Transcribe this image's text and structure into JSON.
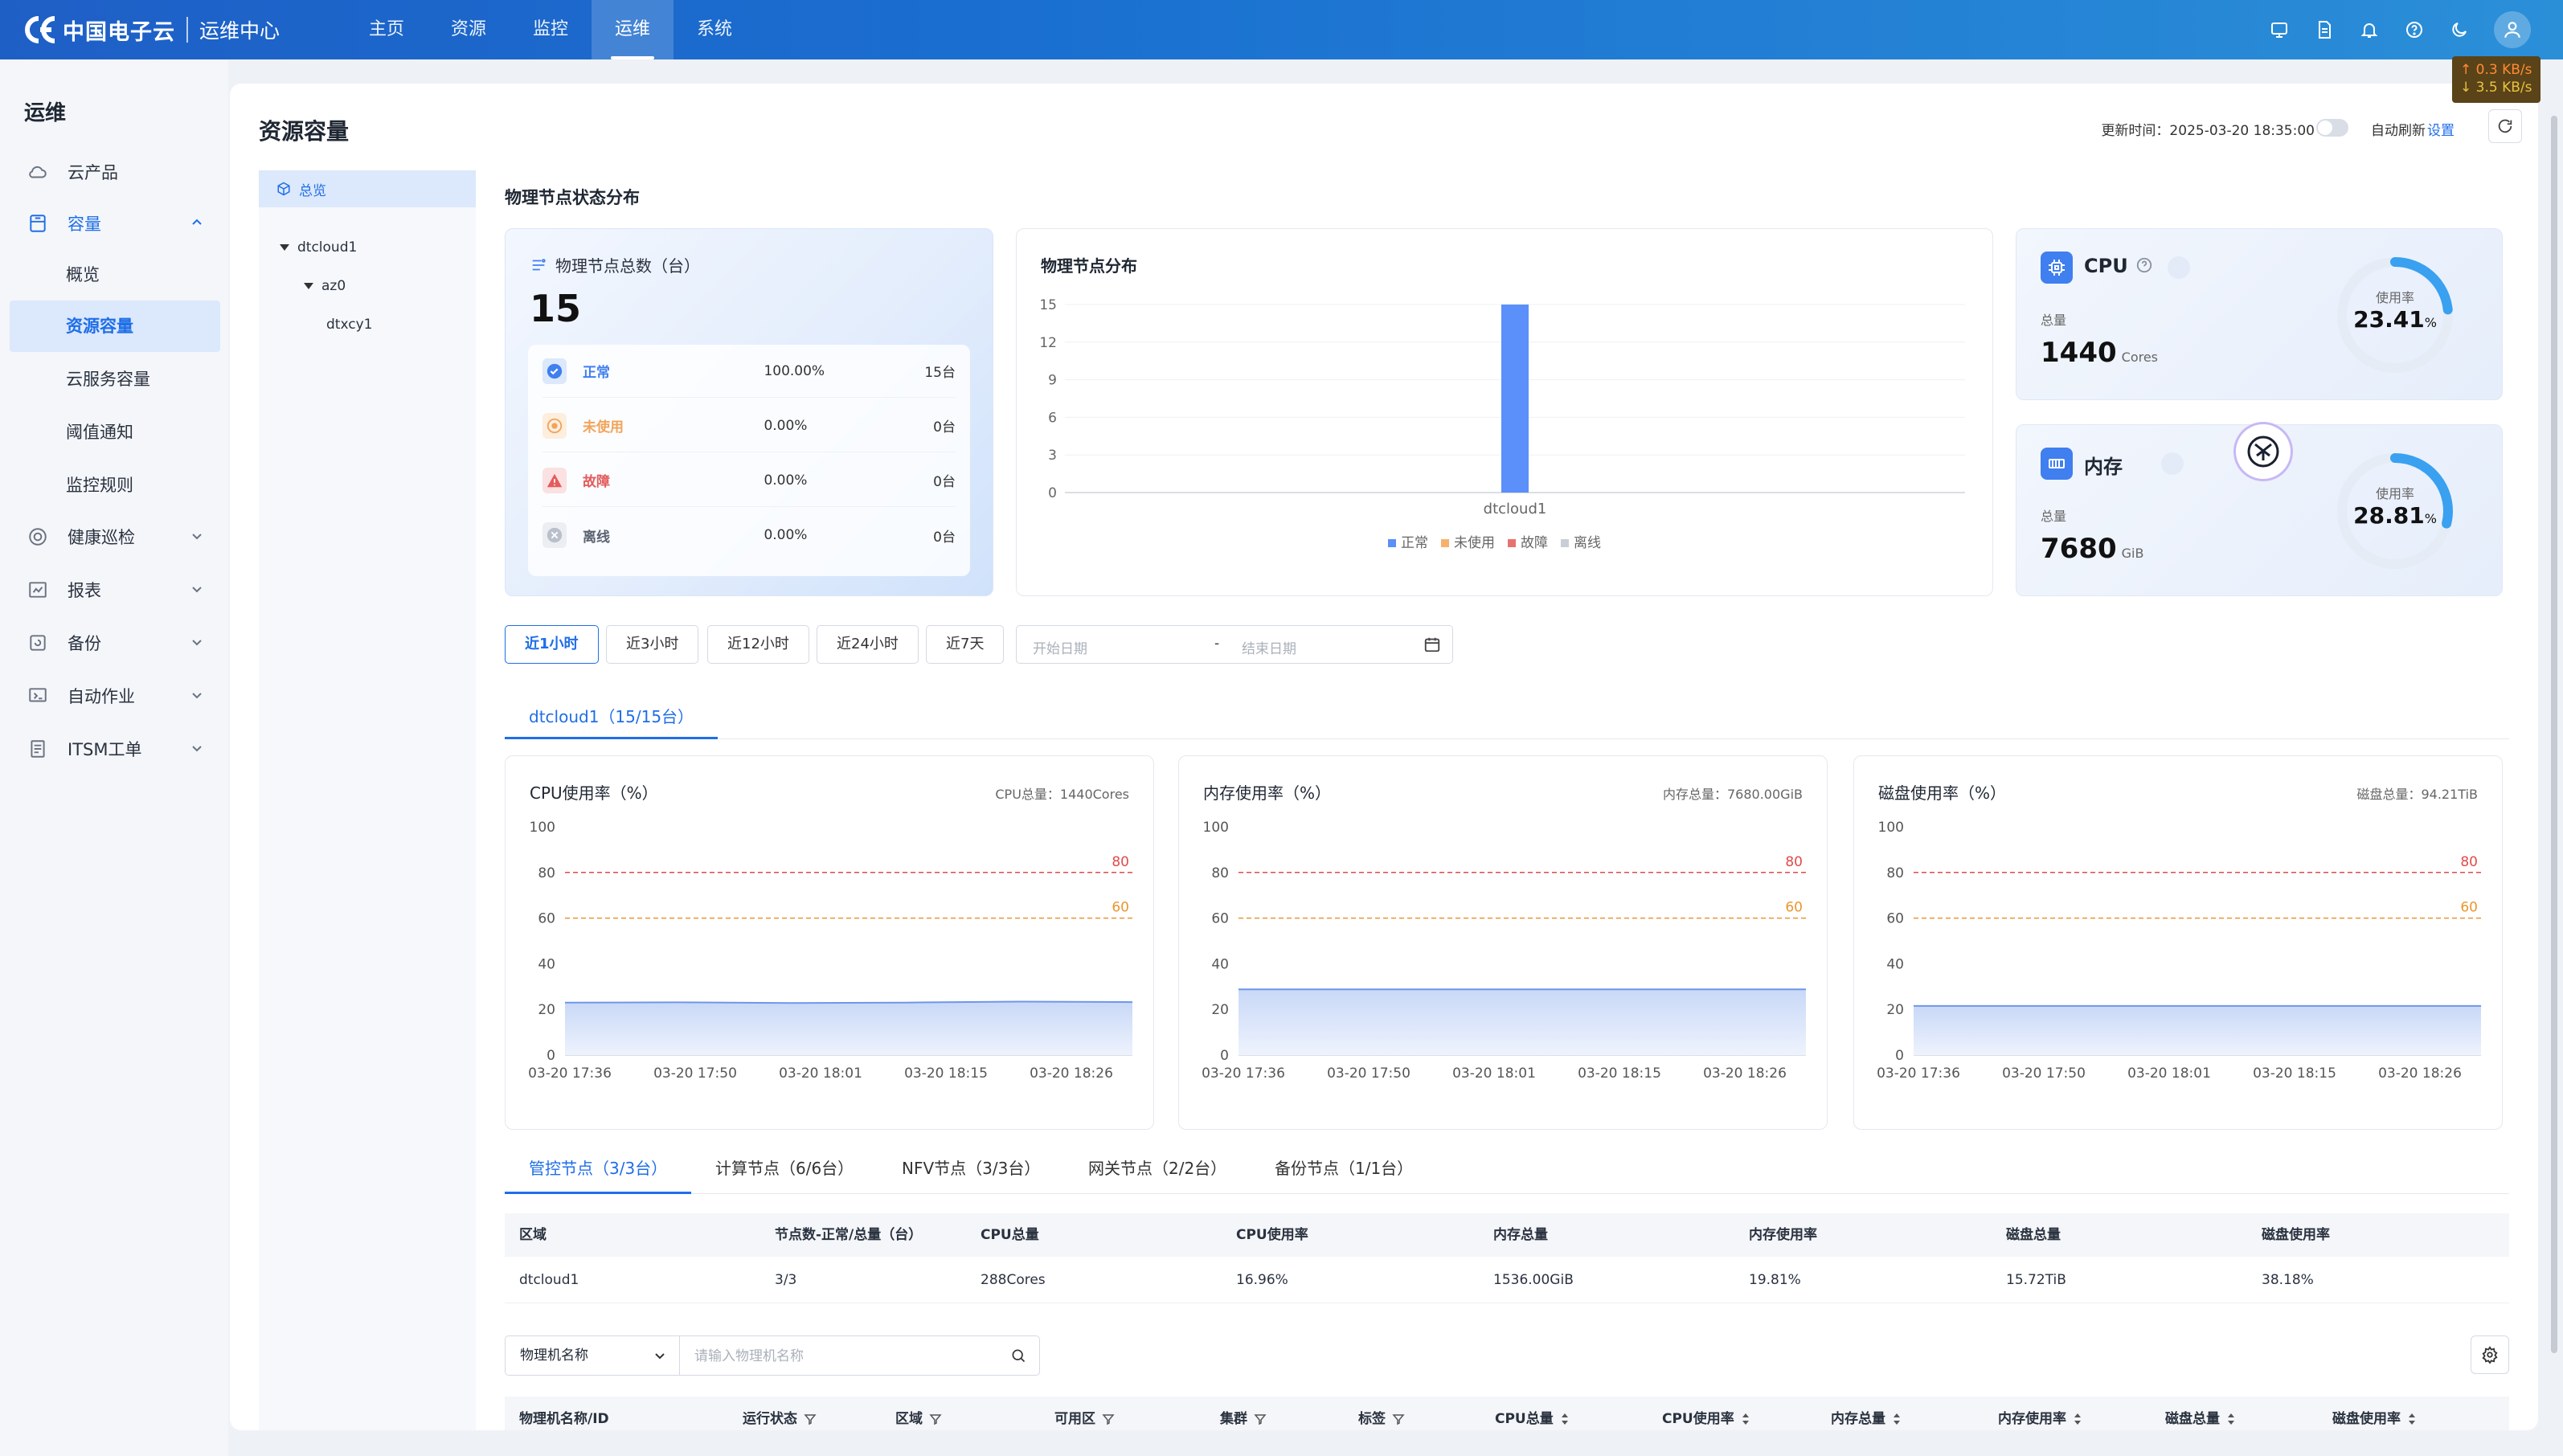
{
  "header": {
    "logo_text": "中国电子云",
    "logo_sub": "运维中心",
    "nav": [
      {
        "label": "主页"
      },
      {
        "label": "资源"
      },
      {
        "label": "监控"
      },
      {
        "label": "运维",
        "active": true
      },
      {
        "label": "系统"
      }
    ],
    "icons": [
      "monitor-icon",
      "document-icon",
      "bell-icon",
      "help-icon",
      "moon-icon"
    ],
    "net_speed": {
      "up": "↑ 0.3 KB/s",
      "down": "↓ 3.5 KB/s"
    }
  },
  "sidebar": {
    "title": "运维",
    "items": [
      {
        "label": "云产品",
        "icon": "cloud-icon"
      },
      {
        "label": "容量",
        "icon": "capacity-icon",
        "open": true,
        "children": [
          {
            "label": "概览"
          },
          {
            "label": "资源容量",
            "active": true
          },
          {
            "label": "云服务容量"
          },
          {
            "label": "阈值通知"
          },
          {
            "label": "监控规则"
          }
        ]
      },
      {
        "label": "健康巡检",
        "icon": "health-icon"
      },
      {
        "label": "报表",
        "icon": "report-icon"
      },
      {
        "label": "备份",
        "icon": "backup-icon"
      },
      {
        "label": "自动作业",
        "icon": "automation-icon"
      },
      {
        "label": "ITSM工单",
        "icon": "ticket-icon"
      }
    ]
  },
  "page": {
    "title": "资源容量",
    "updated": "更新时间：2025-03-20 18:35:00",
    "auto_refresh": "自动刷新",
    "settings": "设置"
  },
  "tree": {
    "overview": "总览",
    "region": "dtcloud1",
    "az": "az0",
    "cluster": "dtxcy1"
  },
  "status": {
    "section_title": "物理节点状态分布",
    "total_label": "物理节点总数（台）",
    "total": "15",
    "rows": [
      {
        "label": "正常",
        "pct": "100.00%",
        "count": "15台",
        "color": "#3f7fef"
      },
      {
        "label": "未使用",
        "pct": "0.00%",
        "count": "0台",
        "color": "#f3a35a"
      },
      {
        "label": "故障",
        "pct": "0.00%",
        "count": "0台",
        "color": "#e45c5c"
      },
      {
        "label": "离线",
        "pct": "0.00%",
        "count": "0台",
        "color": "#b9c0cc"
      }
    ]
  },
  "chart_data": [
    {
      "type": "bar",
      "title": "物理节点分布",
      "categories": [
        "dtcloud1"
      ],
      "series": [
        {
          "name": "正常",
          "values": [
            15
          ],
          "color": "#5b8ff9"
        },
        {
          "name": "未使用",
          "values": [
            0
          ],
          "color": "#f6b26b"
        },
        {
          "name": "故障",
          "values": [
            0
          ],
          "color": "#e67370"
        },
        {
          "name": "离线",
          "values": [
            0
          ],
          "color": "#c9ced6"
        }
      ],
      "yticks": [
        0,
        3,
        6,
        9,
        12,
        15
      ],
      "ylim": [
        0,
        15
      ],
      "legend": "bottom"
    },
    {
      "type": "area",
      "title": "CPU使用率（%）",
      "total": "CPU总量：1440Cores",
      "x": [
        "03-20 17:36",
        "03-20 17:50",
        "03-20 18:01",
        "03-20 18:15",
        "03-20 18:26"
      ],
      "series": [
        {
          "values": [
            23.0,
            23.1,
            22.8,
            23.0,
            23.4,
            23.2
          ]
        }
      ],
      "thresholds": [
        {
          "value": 80,
          "color": "#e14b4b"
        },
        {
          "value": 60,
          "color": "#e8972f"
        }
      ],
      "yticks": [
        0,
        20,
        40,
        60,
        80,
        100
      ],
      "ylim": [
        0,
        100
      ]
    },
    {
      "type": "area",
      "title": "内存使用率（%）",
      "total": "内存总量：7680.00GiB",
      "x": [
        "03-20 17:36",
        "03-20 17:50",
        "03-20 18:01",
        "03-20 18:15",
        "03-20 18:26"
      ],
      "series": [
        {
          "values": [
            28.8,
            28.8,
            28.8,
            28.8,
            28.8,
            28.8
          ]
        }
      ],
      "thresholds": [
        {
          "value": 80,
          "color": "#e14b4b"
        },
        {
          "value": 60,
          "color": "#e8972f"
        }
      ],
      "yticks": [
        0,
        20,
        40,
        60,
        80,
        100
      ],
      "ylim": [
        0,
        100
      ]
    },
    {
      "type": "area",
      "title": "磁盘使用率（%）",
      "total": "磁盘总量：94.21TiB",
      "x": [
        "03-20 17:36",
        "03-20 17:50",
        "03-20 18:01",
        "03-20 18:15",
        "03-20 18:26"
      ],
      "series": [
        {
          "values": [
            21.5,
            21.5,
            21.5,
            21.5,
            21.5,
            21.5
          ]
        }
      ],
      "thresholds": [
        {
          "value": 80,
          "color": "#e14b4b"
        },
        {
          "value": 60,
          "color": "#e8972f"
        }
      ],
      "yticks": [
        0,
        20,
        40,
        60,
        80,
        100
      ],
      "ylim": [
        0,
        100
      ]
    }
  ],
  "resources": {
    "cpu": {
      "name": "CPU",
      "total_label": "总量",
      "total": "1440",
      "unit": "Cores",
      "usage_label": "使用率",
      "usage": "23.41",
      "usage_value": 23.41
    },
    "mem": {
      "name": "内存",
      "total_label": "总量",
      "total": "7680",
      "unit": "GiB",
      "usage_label": "使用率",
      "usage": "28.81",
      "usage_value": 28.81
    }
  },
  "time_range": {
    "buttons": [
      {
        "label": "近1小时",
        "active": true
      },
      {
        "label": "近3小时"
      },
      {
        "label": "近12小时"
      },
      {
        "label": "近24小时"
      },
      {
        "label": "近7天"
      }
    ],
    "start_placeholder": "开始日期",
    "end_placeholder": "结束日期"
  },
  "region_tab": "dtcloud1（15/15台）",
  "node_tabs": [
    {
      "label": "管控节点（3/3台）",
      "active": true
    },
    {
      "label": "计算节点（6/6台）"
    },
    {
      "label": "NFV节点（3/3台）"
    },
    {
      "label": "网关节点（2/2台）"
    },
    {
      "label": "备份节点（1/1台）"
    }
  ],
  "summary_table": {
    "headers": [
      "区域",
      "节点数-正常/总量（台）",
      "CPU总量",
      "CPU使用率",
      "内存总量",
      "内存使用率",
      "磁盘总量",
      "磁盘使用率"
    ],
    "rows": [
      [
        "dtcloud1",
        "3/3",
        "288Cores",
        "16.96%",
        "1536.00GiB",
        "19.81%",
        "15.72TiB",
        "38.18%"
      ]
    ]
  },
  "filter": {
    "select_value": "物理机名称",
    "placeholder": "请输入物理机名称"
  },
  "machine_table": {
    "headers": [
      "物理机名称/ID",
      "运行状态",
      "区域",
      "可用区",
      "集群",
      "标签",
      "CPU总量",
      "CPU使用率",
      "内存总量",
      "内存使用率",
      "磁盘总量",
      "磁盘使用率"
    ]
  }
}
